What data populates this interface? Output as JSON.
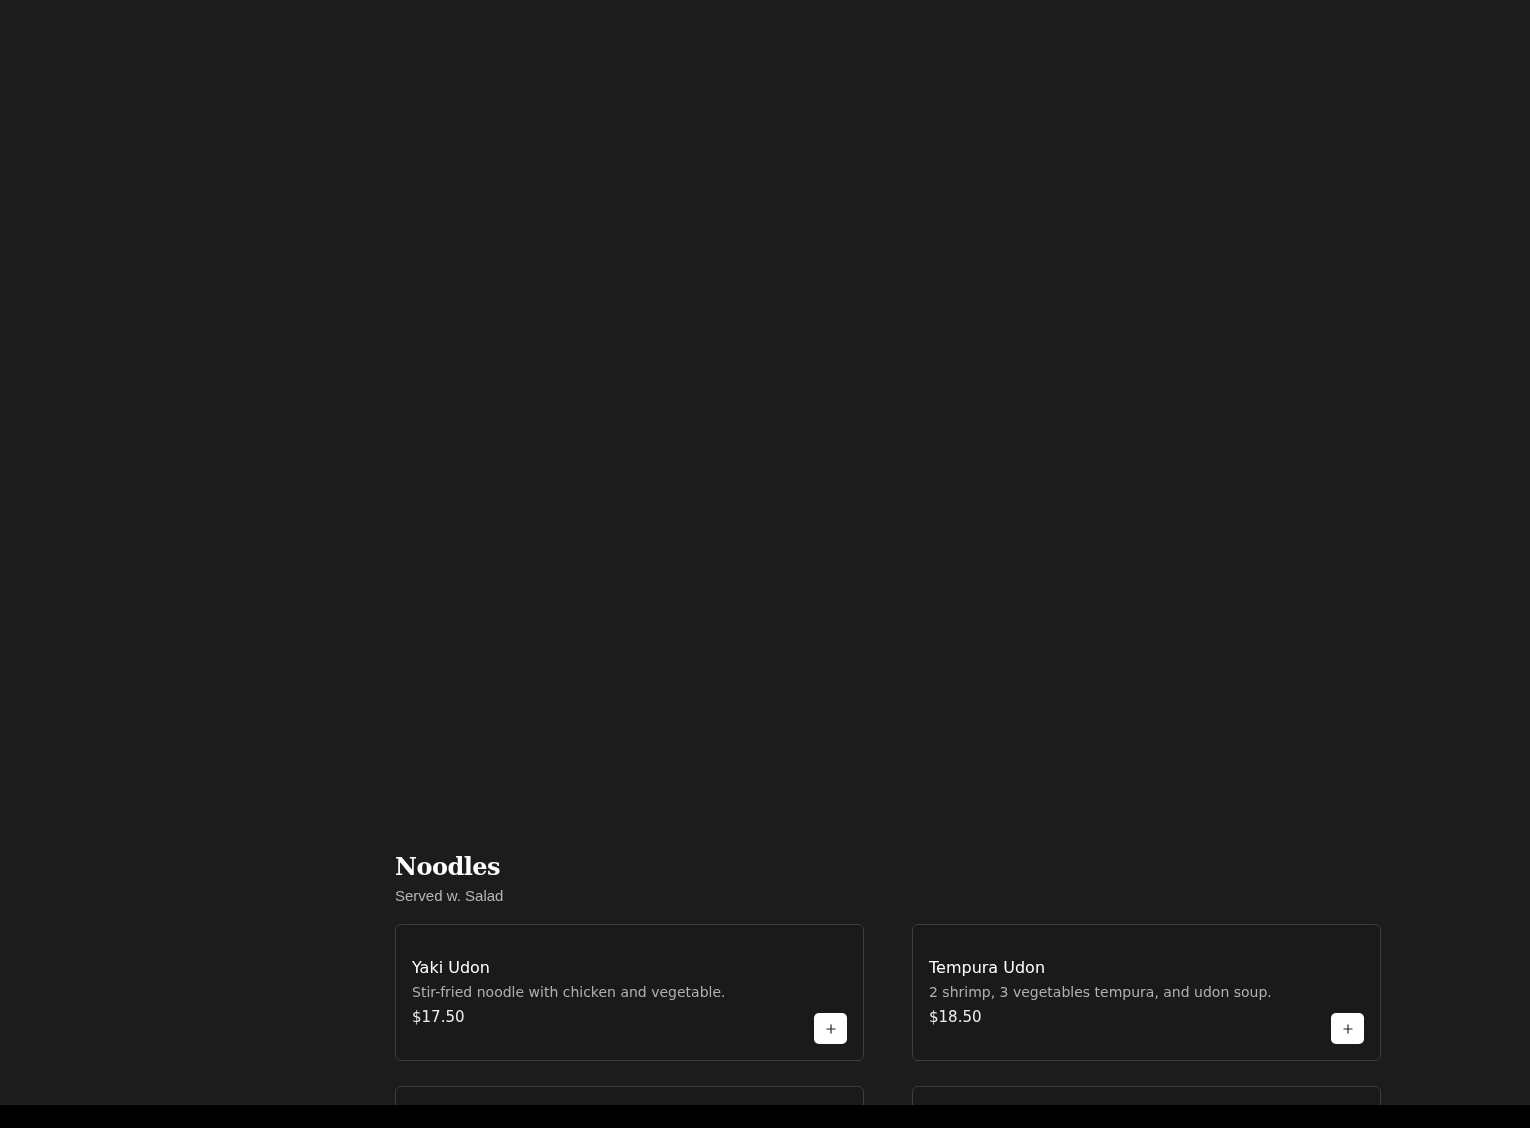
{
  "section": {
    "title": "Noodles",
    "subtitle": "Served w. Salad"
  },
  "items": [
    {
      "kind": "dish",
      "name": "Yaki Udon",
      "description": "Stir-fried noodle with chicken and vegetable.",
      "price": "$17.50"
    },
    {
      "kind": "dish",
      "name": "Tempura Udon",
      "description": "2 shrimp, 3 vegetables tempura, and udon soup.",
      "price": "$18.50"
    },
    {
      "kind": "cut"
    },
    {
      "kind": "cut"
    }
  ]
}
